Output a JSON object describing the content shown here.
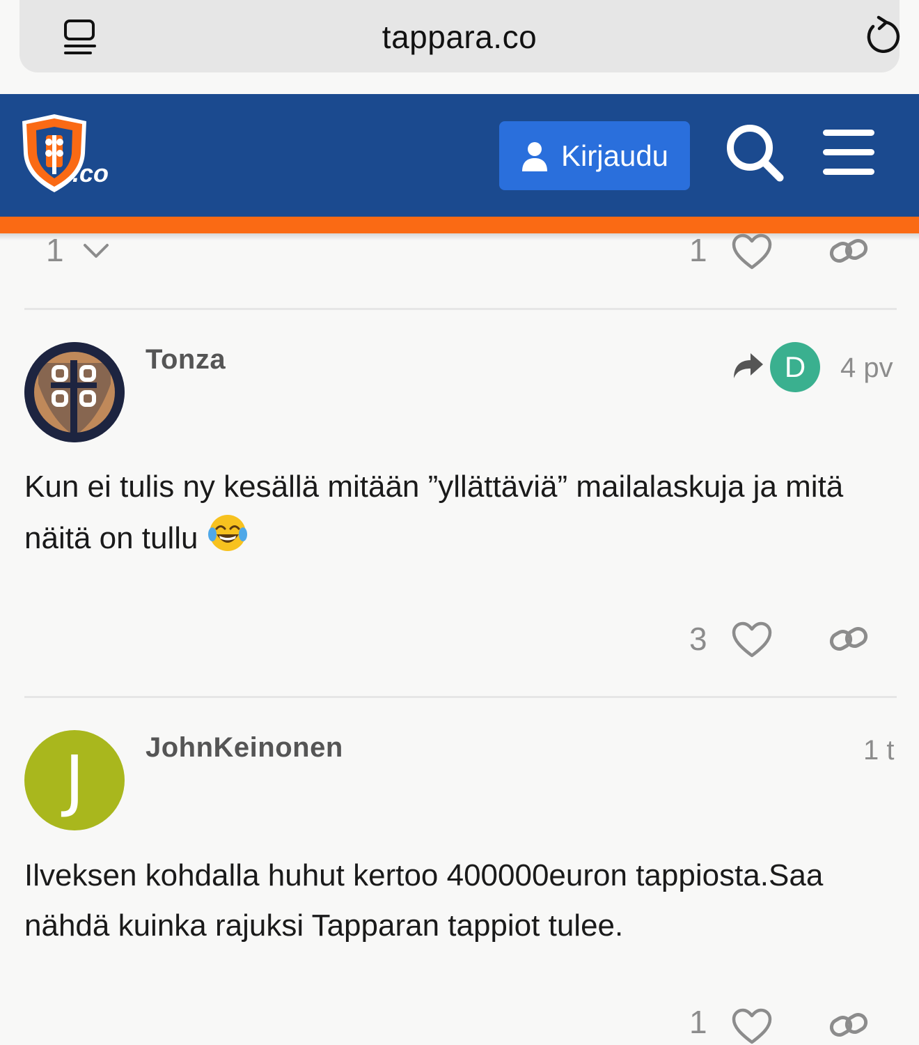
{
  "browser": {
    "url": "tappara.co"
  },
  "header": {
    "logo_text": ".co",
    "login_label": "Kirjaudu"
  },
  "prev_post": {
    "replies_count": "1",
    "likes_count": "1"
  },
  "posts": [
    {
      "username": "Tonza",
      "reply_to_initial": "D",
      "date": "4 pv",
      "body": "Kun ei tulis ny kesällä mitään ”yllättäviä” mailalaskuja ja mitä näitä on tullu",
      "emoji": "joy",
      "likes_count": "3"
    },
    {
      "username": "JohnKeinonen",
      "avatar_initial": "J",
      "date": "1 t",
      "body": "Ilveksen kohdalla huhut kertoo 400000euron tappiosta.Saa nähdä kuinka rajuksi Tapparan tappiot tulee.",
      "likes_count": "1"
    }
  ],
  "colors": {
    "header_blue": "#1b4a8f",
    "header_orange": "#fa6a14",
    "button_blue": "#2a6fdc",
    "avatar_d_green": "#3ab08f",
    "avatar_j_olive": "#a9b71d"
  }
}
